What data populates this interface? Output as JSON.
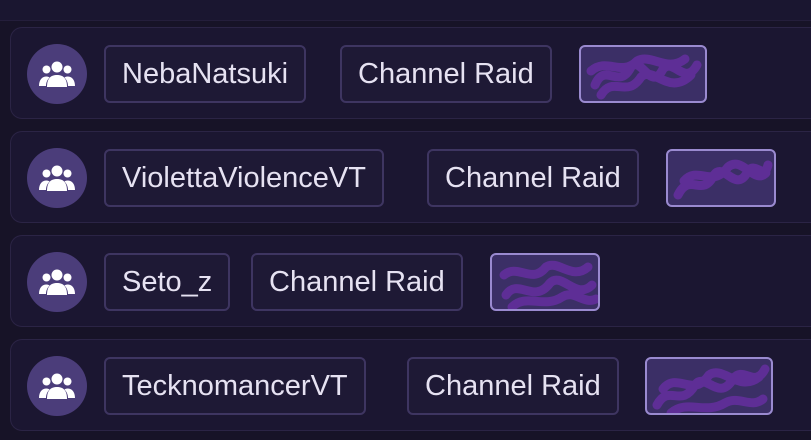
{
  "events": [
    {
      "icon": "raid-group-icon",
      "username": "NebaNatsuki",
      "event_type": "Channel Raid",
      "viewer_count": ""
    },
    {
      "icon": "raid-group-icon",
      "username": "ViolettaViolenceVT",
      "event_type": "Channel Raid",
      "viewer_count": ""
    },
    {
      "icon": "raid-group-icon",
      "username": "Seto_z",
      "event_type": "Channel Raid",
      "viewer_count": ""
    },
    {
      "icon": "raid-group-icon",
      "username": "TecknomancerVT",
      "event_type": "Channel Raid",
      "viewer_count": ""
    }
  ],
  "colors": {
    "background": "#171327",
    "row": "#1b1631",
    "icon_circle": "#4b3d7a",
    "pill_border": "#3e3561",
    "amount_fill": "#3b2f66",
    "amount_border": "#9a8ad0",
    "redaction_scribble": "#5e2e96",
    "text": "#e6e2f2"
  }
}
